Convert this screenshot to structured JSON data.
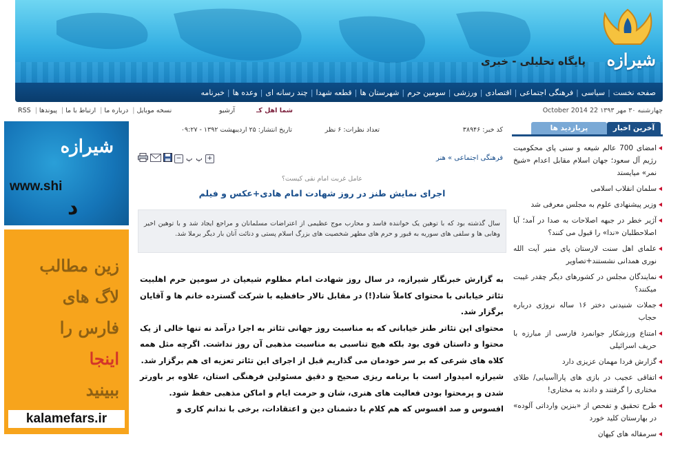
{
  "header": {
    "logo_text": "شیرازه",
    "tagline": "پایگاه تحلیلی - خبری",
    "nav": [
      "صفحه نخست",
      "سیاسی",
      "فرهنگی اجتماعی",
      "اقتصادی",
      "ورزشی",
      "سومین حرم",
      "شهرستان ها",
      "قطعه شهدا",
      "چند رسانه ای",
      "وعده ها",
      "خبرنامه"
    ]
  },
  "topstrip": {
    "date": "چهارشنبه ۳۰ مهر ۱۳۹۳  22 October 2014",
    "ahl": "شما اهل کـ",
    "archive": "آرشیو",
    "links": [
      "نسخه موبایل",
      "درباره ما",
      "ارتباط با ما",
      "پیوندها",
      "RSS"
    ]
  },
  "ads": {
    "ad1_title": "شیرازه",
    "ad1_url": "www.shi",
    "ad2_lines": [
      "زین مطالب",
      "لاگ های",
      "فارس را",
      "اینجا",
      "ببینید"
    ],
    "ad2_url": "kalamefars.ir"
  },
  "article": {
    "code": "کد خبر: ۳۸۹۴۶",
    "views": "تعداد نظرات: ۶ نظر",
    "published": "تاریخ انتشار: ۲۵ اردیبهشت ۱۳۹۲ - ۰۹:۲۷",
    "breadcrumb": "فرهنگی اجتماعی » هنر",
    "tools": {
      "plus": "+",
      "pe1": "پ",
      "pe2": "پ",
      "minus": "−"
    },
    "subtitle": "عامل غربت امام نقی کیست؟",
    "title": "اجرای نمایش طنز در روز شهادت امام هادی+عکس و فیلم",
    "lead": "سال گذشته بود که با توهین یک خواننده فاسد و محارب موج عظیمی از اعتراضات مسلمانان و مراجع ایجاد شد و با توهین اخیر وهابی ها و سلفی های سوریه به قبور و حرم های مطهر شخصیت های بزرگ اسلام پستی و دنائت آنان بار دیگر برملا شد.",
    "paragraphs": [
      "به گزارش خبرنگار شیرازه، در سال روز شهادت امام مظلوم شیعیان در سومین حرم اهلبیت تئاتر خیابانی با محتوای کاملاً شاد(!) در مقابل تالار حافظیه با شرکت گسترده خانم ها و آقایان برگزار شد.",
      "محتوای این تئاتر طنز خیابانی که به مناسبت روز جهانی تئاتر به اجرا درآمد نه تنها خالی از یک محتوا و داستان قوی بود بلکه هیچ تناسبی به مناسبت مذهبی آن روز نداشت. اگرچه مثل همه کلاه های شرعی که بر سر خودمان می گذاریم قبل از اجرای این تئاتر تعزیه ای هم برگزار شد.",
      "شیرازه امیدوار است با برنامه ریزی صحیح و دقیق مسئولین فرهنگی استان، علاوه بر باورتر شدن و پرمحتوا بودن فعالیت های هنری، شان و حرمت ایام و اماکن مذهبی حفظ شود.",
      "افسوس و صد افسوس که هم کلام با دشمنان دین و اعتقادات، برخی با ندانم کاری و"
    ]
  },
  "sidebar": {
    "tab_latest": "آخرین اخبار",
    "tab_popular": "پربازدید ها",
    "items": [
      "امضای 700 عالم شیعه و سنی پای محکومیت رژیم آل سعود؛ جهان اسلام مقابل اعدام «شیخ نمر» میایستد",
      "سلمان انقلاب اسلامی",
      "وزیر پیشنهادی علوم به مجلس معرفی شد",
      "آژیر خطر در جبهه اصلاحات به صدا در آمد؛ آیا اصلاحطلبان «ندا» را قبول می کنند؟",
      "علمای اهل سنت لارستان پای منبر آیت الله نوری همدانی نشستند+تصاویر",
      "نمایندگان مجلس در کشورهای دیگر چقدر غیبت میکنند؟",
      "جملات شنیدنی دختر ۱۶ ساله نروژی درباره حجاب",
      "امتناع ورزشکار جوانمرد فارسی از مبارزه با حریف اسرائیلی",
      "گزارش فردا مهمان عزیزی دارد",
      "اتفاقی عجیب در بازی های پاراآسیایی/ طلای مختاری را گرفتند و دادند به مختاری!",
      "طرح تحقیق و تفحص از «بنزین وارداتی آلوده» در بهارستان کلید خورد",
      "سرمقاله های کیهان"
    ]
  }
}
